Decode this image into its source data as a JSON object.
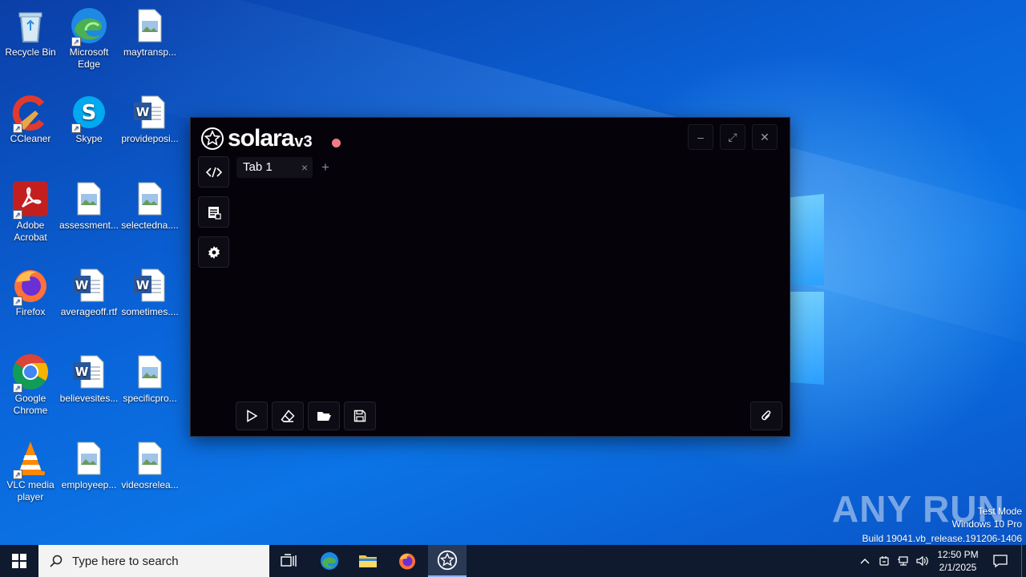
{
  "desktop": {
    "icons": [
      {
        "name": "recycle-bin",
        "label": "Recycle Bin",
        "icon": "recycle-bin-icon"
      },
      {
        "name": "microsoft-edge",
        "label": "Microsoft Edge",
        "icon": "edge-icon"
      },
      {
        "name": "maytransp",
        "label": "maytransp...",
        "icon": "image-file-icon"
      },
      {
        "name": "ccleaner",
        "label": "CCleaner",
        "icon": "ccleaner-icon"
      },
      {
        "name": "skype",
        "label": "Skype",
        "icon": "skype-icon"
      },
      {
        "name": "provideposi",
        "label": "provideposi...",
        "icon": "word-file-icon"
      },
      {
        "name": "adobe-acrobat",
        "label": "Adobe Acrobat",
        "icon": "acrobat-icon"
      },
      {
        "name": "assessment",
        "label": "assessment...",
        "icon": "image-file-icon"
      },
      {
        "name": "selectedna",
        "label": "selectedna....",
        "icon": "image-file-icon"
      },
      {
        "name": "firefox",
        "label": "Firefox",
        "icon": "firefox-icon"
      },
      {
        "name": "averageoff",
        "label": "averageoff.rtf",
        "icon": "word-file-icon"
      },
      {
        "name": "sometimes",
        "label": "sometimes....",
        "icon": "word-file-icon"
      },
      {
        "name": "google-chrome",
        "label": "Google Chrome",
        "icon": "chrome-icon"
      },
      {
        "name": "believesites",
        "label": "believesites...",
        "icon": "word-file-icon"
      },
      {
        "name": "specificpro",
        "label": "specificpro...",
        "icon": "image-file-icon"
      },
      {
        "name": "vlc-media-player",
        "label": "VLC media player",
        "icon": "vlc-icon"
      },
      {
        "name": "employeep",
        "label": "employeep...",
        "icon": "image-file-icon"
      },
      {
        "name": "videosrelea",
        "label": "videosrelea...",
        "icon": "image-file-icon"
      }
    ]
  },
  "solara": {
    "logo_name": "solara",
    "logo_version": "v3",
    "status_color": "#f07c86",
    "tabs": [
      {
        "label": "Tab 1"
      }
    ],
    "tab_add": "+",
    "tab_close": "×"
  },
  "watermark": {
    "brand": "ANY RUN",
    "mode": "Test Mode",
    "edition": "Windows 10 Pro",
    "build": "Build 19041.vb_release.191206-1406"
  },
  "taskbar": {
    "search_placeholder": "Type here to search",
    "time": "12:50 PM",
    "date": "2/1/2025"
  }
}
